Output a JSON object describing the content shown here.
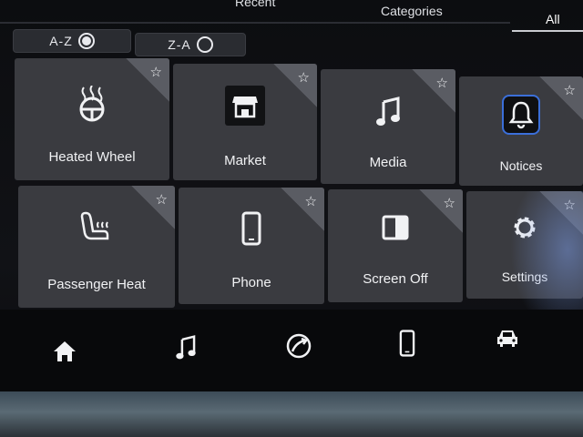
{
  "tabs": {
    "recent": "Recent",
    "categories": "Categories",
    "all": "All"
  },
  "sort": {
    "az": "A-Z",
    "za": "Z-A",
    "selected": "A-Z"
  },
  "apps": [
    {
      "label": "Heated Wheel",
      "icon": "heated-wheel-icon"
    },
    {
      "label": "Market",
      "icon": "market-icon"
    },
    {
      "label": "Media",
      "icon": "music-note-icon"
    },
    {
      "label": "Notices",
      "icon": "bell-icon"
    },
    {
      "label": "Passenger Heat",
      "icon": "heated-seat-icon"
    },
    {
      "label": "Phone",
      "icon": "phone-icon"
    },
    {
      "label": "Screen Off",
      "icon": "screen-off-icon"
    },
    {
      "label": "Settings",
      "icon": "gear-icon"
    }
  ],
  "favorite_glyph": "☆",
  "bottom_nav": [
    "home-icon",
    "music-icon",
    "navigation-icon",
    "phone-icon",
    "vehicle-icon"
  ],
  "colors": {
    "tile": "#3a3b40",
    "accent_notice": "#3b6fd9"
  }
}
